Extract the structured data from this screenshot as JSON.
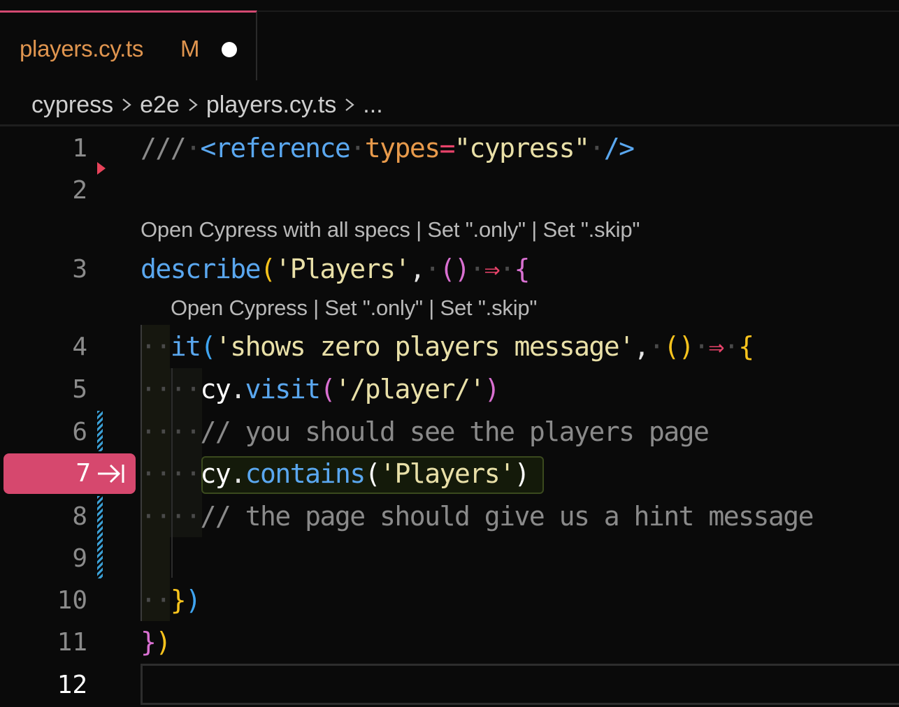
{
  "tab": {
    "filename": "players.cy.ts",
    "status": "M",
    "unsaved_indicator": "unsaved-dot"
  },
  "breadcrumb": [
    "cypress",
    "e2e",
    "players.cy.ts",
    "..."
  ],
  "codelens": {
    "describe": "Open Cypress with all specs | Set \".only\" | Set \".skip\"",
    "it": "Open Cypress | Set \".only\" | Set \".skip\""
  },
  "line_numbers": [
    "1",
    "2",
    "3",
    "4",
    "5",
    "6",
    "7",
    "8",
    "9",
    "10",
    "11",
    "12"
  ],
  "code": {
    "l1": {
      "comment": "///",
      "tag_open": "<reference",
      "attr": "types",
      "eq": "=",
      "value": "\"cypress\"",
      "tag_close": "/>"
    },
    "l3": {
      "fn": "describe",
      "open": "(",
      "str": "'Players'",
      "comma": ",",
      "parens": "()",
      "arrow": "⇒",
      "brace": "{"
    },
    "l4": {
      "fn": "it",
      "open": "(",
      "str": "'shows zero players message'",
      "comma": ",",
      "parens": "()",
      "arrow": "⇒",
      "brace": "{"
    },
    "l5": {
      "obj": "cy",
      "dot": ".",
      "fn": "visit",
      "open": "(",
      "str": "'/player/'",
      "close": ")"
    },
    "l6": {
      "comment": "// you should see the players page"
    },
    "l7": {
      "obj": "cy",
      "dot": ".",
      "fn": "contains",
      "open": "(",
      "str": "'Players'",
      "close": ")"
    },
    "l8": {
      "comment": "// the page should give us a hint message"
    },
    "l10": {
      "brace": "}",
      "paren": ")"
    },
    "l11": {
      "brace": "}",
      "paren": ")"
    }
  },
  "debug": {
    "current_line": "7",
    "icon": "step-arrow-icon"
  },
  "colors": {
    "tab_accent": "#d44a72",
    "modified": "#e0954f",
    "debug_badge": "#d6486e",
    "keyword_blue": "#5aa7ef",
    "string": "#e9e0a8",
    "comment": "#8a8a8a",
    "bracket_yellow": "#f8c31d",
    "bracket_pink": "#d970d1",
    "bracket_blue": "#3fa4f0",
    "arrow": "#e8436a"
  }
}
